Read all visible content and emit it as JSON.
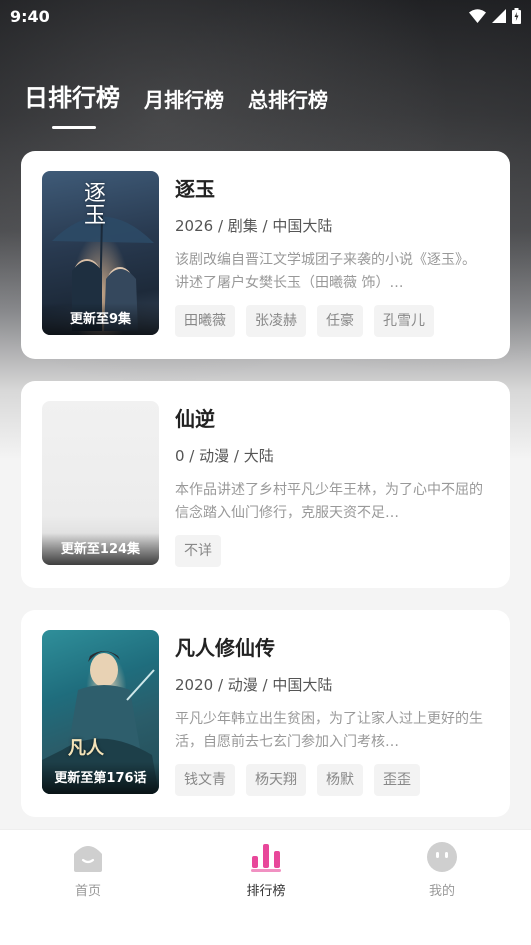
{
  "status_bar": {
    "time": "9:40"
  },
  "tabs": [
    {
      "label": "日排行榜",
      "active": true
    },
    {
      "label": "月排行榜",
      "active": false
    },
    {
      "label": "总排行榜",
      "active": false
    }
  ],
  "cards": [
    {
      "title": "逐玉",
      "meta": "2026 / 剧集 / 中国大陆",
      "description": "该剧改编自晋江文学城团子来袭的小说《逐玉》。讲述了屠户女樊长玉（田曦薇 饰）…",
      "badge": "更新至9集",
      "poster_text": "逐玉",
      "tags": [
        "田曦薇",
        "张凌赫",
        "任豪",
        "孔雪儿"
      ]
    },
    {
      "title": "仙逆",
      "meta": "0 / 动漫 / 大陆",
      "description": "本作品讲述了乡村平凡少年王林，为了心中不屈的信念踏入仙门修行，克服天资不足…",
      "badge": "更新至124集",
      "tags": [
        "不详"
      ]
    },
    {
      "title": "凡人修仙传",
      "meta": "2020 / 动漫 / 中国大陆",
      "description": "平凡少年韩立出生贫困，为了让家人过上更好的生活，自愿前去七玄门参加入门考核…",
      "badge": "更新至第176话",
      "poster_text": "凡人",
      "tags": [
        "钱文青",
        "杨天翔",
        "杨默",
        "歪歪"
      ]
    }
  ],
  "bottom_nav": [
    {
      "label": "首页",
      "icon": "home-icon",
      "active": false
    },
    {
      "label": "排行榜",
      "icon": "ranking-icon",
      "active": true
    },
    {
      "label": "我的",
      "icon": "profile-icon",
      "active": false
    }
  ],
  "colors": {
    "accent": "#e8479a",
    "nav_inactive": "#cfcfcf"
  }
}
